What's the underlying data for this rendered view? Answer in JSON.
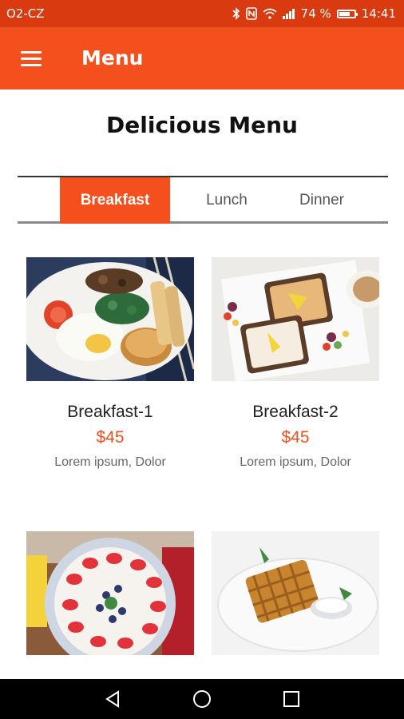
{
  "status_bar": {
    "carrier": "O2-CZ",
    "battery": "74 %",
    "time": "14:41",
    "battery_level": 0.74
  },
  "app_bar": {
    "title": "Menu"
  },
  "heading": "Delicious Menu",
  "tabs": [
    {
      "label": "Breakfast",
      "active": true
    },
    {
      "label": "Lunch",
      "active": false
    },
    {
      "label": "Dinner",
      "active": false
    }
  ],
  "items": [
    {
      "name": "Breakfast-1",
      "price": "$45",
      "description": "Lorem ipsum, Dolor"
    },
    {
      "name": "Breakfast-2",
      "price": "$45",
      "description": "Lorem ipsum, Dolor"
    }
  ],
  "colors": {
    "accent": "#f4501e",
    "status_bar": "#d93a10"
  }
}
